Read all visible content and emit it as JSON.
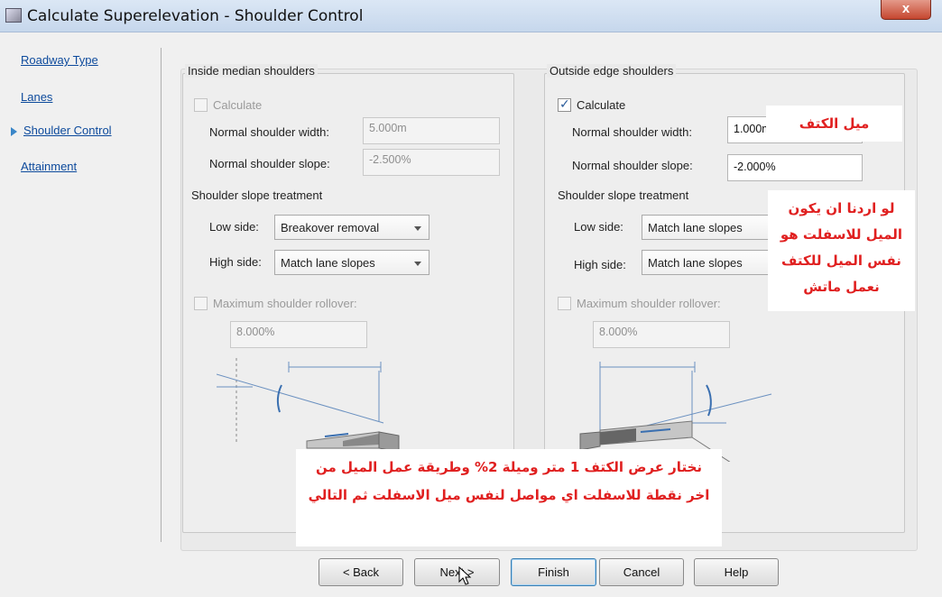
{
  "window": {
    "title": "Calculate Superelevation - Shoulder Control",
    "close_label": "x"
  },
  "nav": {
    "items": [
      {
        "label": "Roadway Type"
      },
      {
        "label": "Lanes"
      },
      {
        "label": "Shoulder Control",
        "active": true
      },
      {
        "label": "Attainment"
      }
    ]
  },
  "inside": {
    "title": "Inside median shoulders",
    "calculate_label": "Calculate",
    "calculate_checked": false,
    "width_label": "Normal shoulder width:",
    "width_value": "5.000m",
    "slope_label": "Normal shoulder slope:",
    "slope_value": "-2.500%",
    "treatment_label": "Shoulder slope treatment",
    "low_label": "Low side:",
    "low_value": "Breakover removal",
    "high_label": "High side:",
    "high_value": "Match lane slopes",
    "rollover_label": "Maximum shoulder rollover:",
    "rollover_value": "8.000%"
  },
  "outside": {
    "title": "Outside edge shoulders",
    "calculate_label": "Calculate",
    "calculate_checked": true,
    "width_label": "Normal shoulder width:",
    "width_value": "1.000m",
    "slope_label": "Normal shoulder slope:",
    "slope_value": "-2.000%",
    "treatment_label": "Shoulder slope treatment",
    "low_label": "Low side:",
    "low_value": "Match lane slopes",
    "high_label": "High side:",
    "high_value": "Match lane slopes",
    "rollover_label": "Maximum shoulder rollover:",
    "rollover_value": "8.000%"
  },
  "annotations": {
    "shoulder_slope": "ميل الكتف",
    "match_note": "لو اردنا ان يكون الميل للاسفلت هو نفس الميل للكتف نعمل ماتش",
    "bottom_note": "نختار عرض الكتف 1 متر وميلة 2% وطريقة عمل الميل من اخر نقطة للاسفلت اي مواصل لنفس ميل الاسفلت ثم التالي"
  },
  "buttons": {
    "back": "< Back",
    "next": "Next >",
    "finish": "Finish",
    "cancel": "Cancel",
    "help": "Help"
  }
}
